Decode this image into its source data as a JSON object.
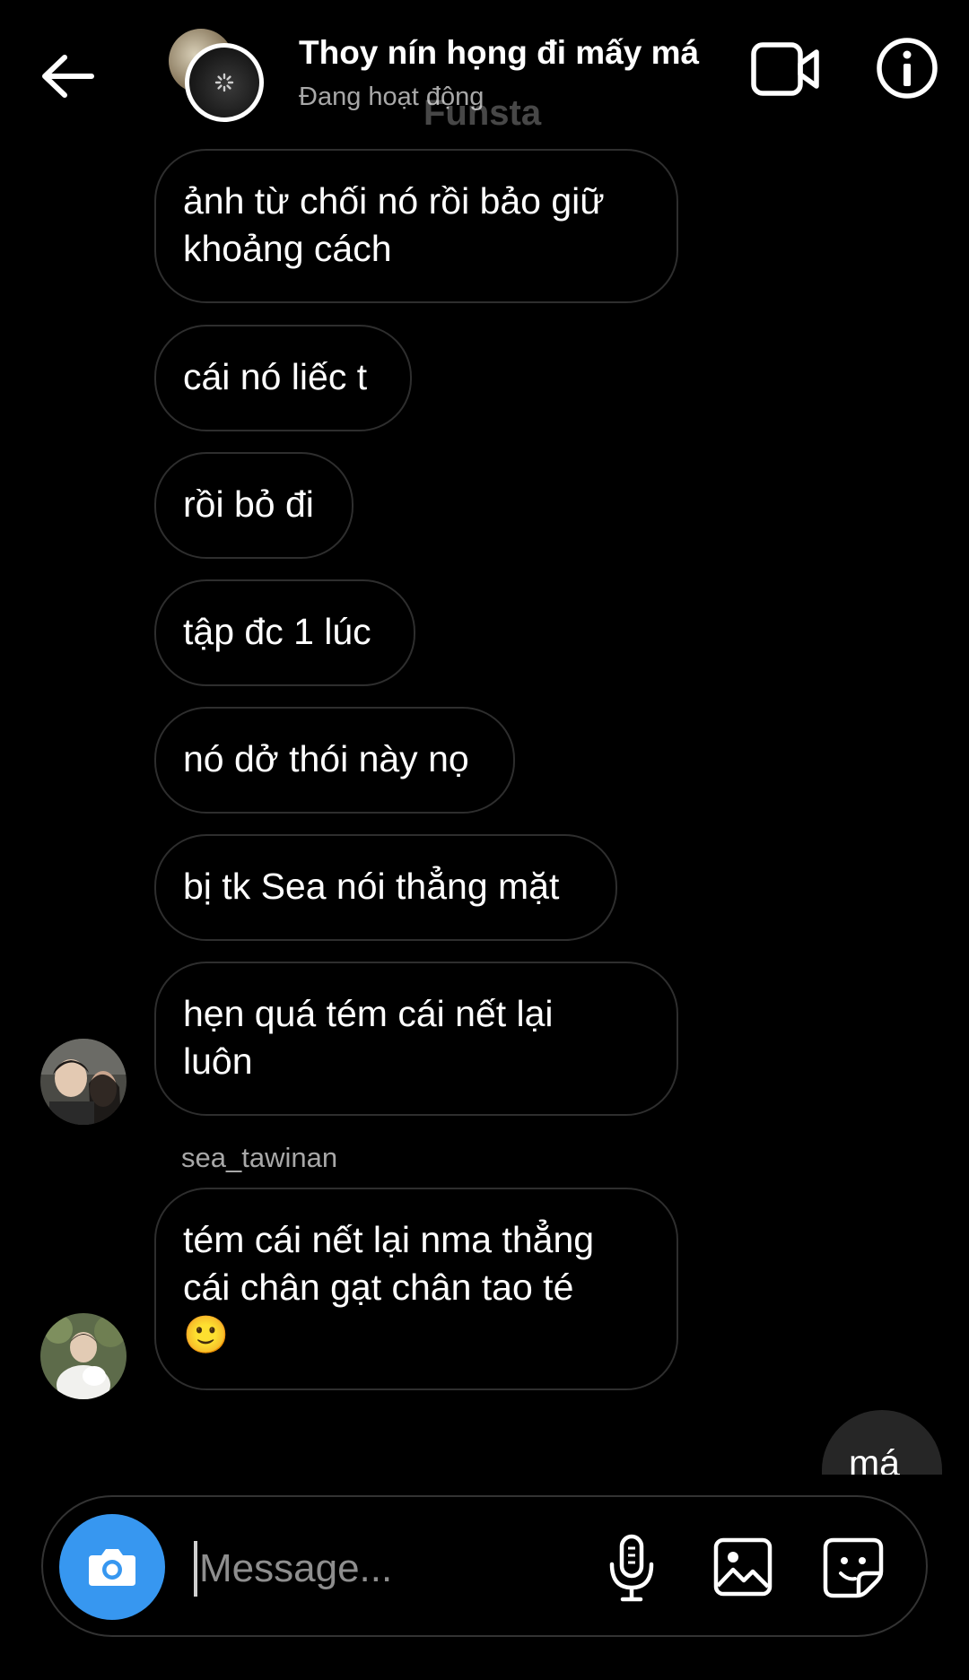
{
  "header": {
    "title": "Thoy nín họng đi mấy má",
    "status": "Đang hoạt động",
    "watermark": "Funsta"
  },
  "messages": [
    {
      "lines": [
        "ảnh từ chối nó rồi bảo giữ",
        "khoảng cách"
      ]
    },
    {
      "lines": [
        "cái nó liếc t"
      ]
    },
    {
      "lines": [
        "rồi bỏ đi"
      ]
    },
    {
      "lines": [
        "tập đc 1 lúc"
      ]
    },
    {
      "lines": [
        "nó dở thói này nọ"
      ]
    },
    {
      "lines": [
        "bị tk Sea nói thẳng mặt"
      ]
    },
    {
      "lines": [
        "hẹn quá tém cái nết lại",
        "luôn"
      ]
    },
    {
      "sender": "sea_tawinan",
      "lines": [
        "tém cái nết lại nma thẳng",
        "cái chân gạt chân tao té",
        "🙂"
      ]
    }
  ],
  "my_message": "má",
  "composer": {
    "placeholder": "Message..."
  },
  "colors": {
    "accent": "#3797f0",
    "bubble_border": "#2e2e2e",
    "my_bubble": "#262626",
    "secondary_text": "#a8a8a8"
  },
  "icons": [
    "back-arrow-icon",
    "video-call-icon",
    "info-icon",
    "camera-icon",
    "microphone-icon",
    "gallery-icon",
    "sticker-icon"
  ]
}
